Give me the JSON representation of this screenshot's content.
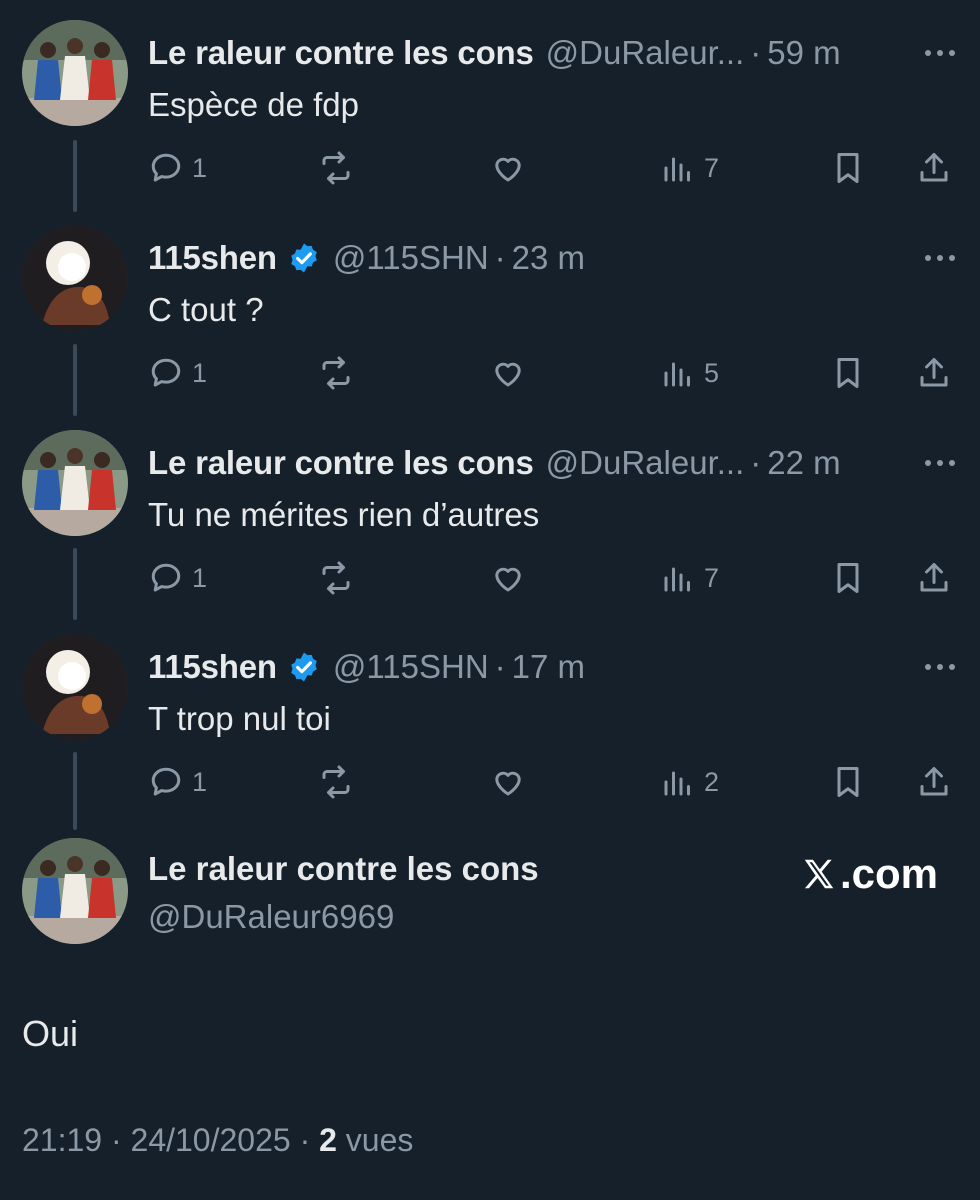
{
  "colors": {
    "background": "#15202b",
    "text": "#e7e9ea",
    "muted": "#8b98a5",
    "verified": "#1d9bf0",
    "thread_line": "#3a4a58"
  },
  "replies": [
    {
      "name": "Le raleur contre les cons",
      "handle": "@DuRaleur...",
      "time": "59 m",
      "text": "Espèce de fdp",
      "verified": false,
      "avatar": "three-women-avatar",
      "reply_count": "1",
      "view_count": "7"
    },
    {
      "name": "115shen",
      "handle": "@115SHN",
      "time": "23 m",
      "text": "C tout ?",
      "verified": true,
      "avatar": "blurred-figure-avatar",
      "reply_count": "1",
      "view_count": "5"
    },
    {
      "name": "Le raleur contre les cons",
      "handle": "@DuRaleur...",
      "time": "22 m",
      "text": "Tu ne mérites rien d’autres",
      "verified": false,
      "avatar": "three-women-avatar",
      "reply_count": "1",
      "view_count": "7"
    },
    {
      "name": "115shen",
      "handle": "@115SHN",
      "time": "17 m",
      "text": "T trop nul toi",
      "verified": true,
      "avatar": "blurred-figure-avatar",
      "reply_count": "1",
      "view_count": "2"
    }
  ],
  "main_post": {
    "name": "Le raleur contre les cons",
    "handle": "@DuRaleur6969",
    "text": "Oui",
    "timestamp": "21:19 · 24/10/2025 ·",
    "views": "2",
    "views_label": "vues",
    "watermark": ".com"
  },
  "separator": "·"
}
